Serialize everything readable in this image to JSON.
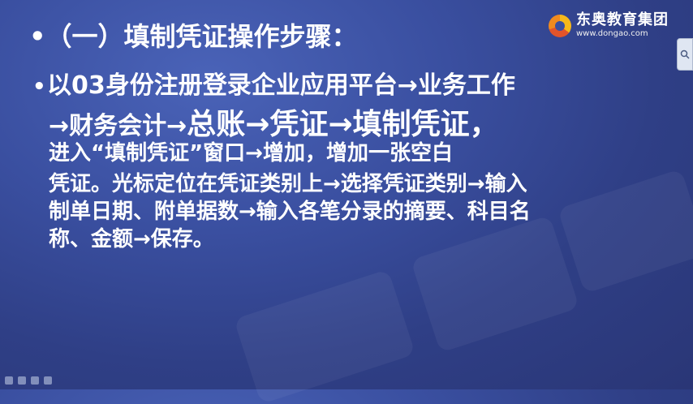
{
  "slide": {
    "title": "•（一）填制凭证操作步骤：",
    "bullet": "•",
    "lines": [
      "以03身份注册登录企业应用平台→业务工作",
      "→财务会计→",
      "总账→凭证→填制凭证，",
      "进入“填制凭证”窗口→增加，增加一张空白",
      "凭证。光标定位在凭证类别上→选择凭证类别→输入",
      "制单日期、附单据数→输入各笔分录的摘要、科目名",
      "称、金额→保存。"
    ]
  },
  "logo": {
    "name": "东奥教育集团",
    "url": "www.dongao.com"
  },
  "colors": {
    "background": "#3a4fa0",
    "text": "#ffffff"
  },
  "icons": {
    "side_button": "search-icon"
  }
}
